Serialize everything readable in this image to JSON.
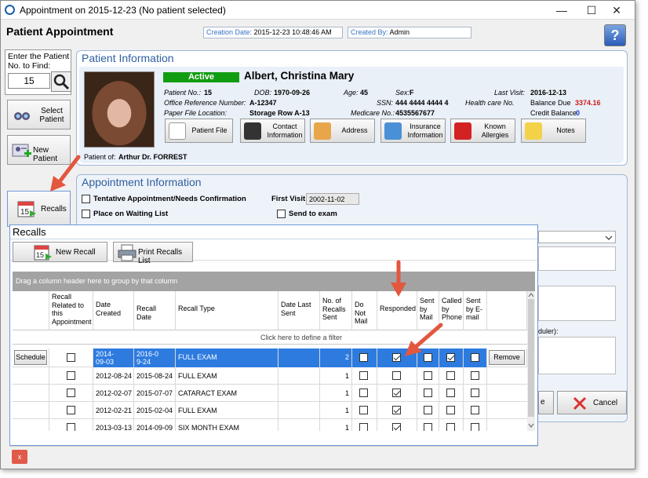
{
  "window": {
    "title": "Appointment on 2015-12-23 (No patient selected)",
    "min": "—",
    "max": "☐",
    "close": "✕"
  },
  "header": {
    "title": "Patient Appointment",
    "creation_label": "Creation Date:",
    "creation_value": "2015-12-23 10:48:46 AM",
    "created_by_label": "Created By:",
    "created_by_value": "Admin",
    "help": "?"
  },
  "sidebar": {
    "find_label": "Enter the Patient No. to Find:",
    "find_value": "15",
    "select_patient": "Select Patient",
    "new_patient": "New Patient",
    "recalls": "Recalls"
  },
  "patient": {
    "section_title": "Patient Information",
    "status": "Active",
    "name": "Albert, Christina Mary",
    "patient_no_label": "Patient No.:",
    "patient_no": "15",
    "dob_label": "DOB:",
    "dob": "1970-09-26",
    "age_label": "Age:",
    "age": "45",
    "sex_label": "Sex:",
    "sex": "F",
    "last_visit_label": "Last Visit:",
    "last_visit": "2016-12-13",
    "office_ref_label": "Office Reference Number:",
    "office_ref": "A-12347",
    "ssn_label": "SSN:",
    "ssn": "444 4444 4444 4",
    "hc_label": "Health care No.",
    "balance_due_label": "Balance Due",
    "balance_due": "3374.16",
    "paper_label": "Paper File Location:",
    "paper": "Storage Row A-13",
    "medicare_label": "Medicare No.:",
    "medicare": "4535567677",
    "credit_label": "Credit Balance",
    "credit": "0",
    "patient_of_label": "Patient of:",
    "patient_of": "Arthur Dr. FORREST",
    "buttons": [
      "Patient File",
      "Contact Information",
      "Address",
      "Insurance Information",
      "Known Allergies",
      "Notes"
    ]
  },
  "appointment": {
    "section_title": "Appointment Information",
    "tentative": "Tentative Appointment/Needs Confirmation",
    "first_visit_label": "First Visit",
    "first_visit": "2002-11-02",
    "waiting": "Place on Waiting List",
    "send_exam": "Send to exam",
    "scheduler_label": "duler):",
    "cancel": "Cancel",
    "partial_btn": "e"
  },
  "recalls": {
    "title": "Recalls",
    "new_recall": "New Recall",
    "print_list": "Print Recalls List",
    "group_hint": "Drag a column header here to group by that column",
    "filter_hint": "Click here to define a filter",
    "columns": [
      "",
      "Recall Related to this Appointment",
      "Date Created",
      "Recall Date",
      "Recall Type",
      "Date Last Sent",
      "No. of Recalls Sent",
      "Do Not Mail",
      "Responded",
      "Sent by Mail",
      "Called by Phone",
      "Sent by E-mail",
      ""
    ],
    "rows": [
      {
        "action": "Schedule",
        "created": "2014-09-03",
        "recall": "2016-09-24",
        "type": "FULL EXAM",
        "last": "",
        "count": "2",
        "remove": "Remove",
        "responded": true,
        "called": true,
        "selected": true
      },
      {
        "created": "2012-08-24",
        "recall": "2015-08-24",
        "type": "FULL EXAM",
        "last": "",
        "count": "1",
        "responded": false
      },
      {
        "created": "2012-02-07",
        "recall": "2015-07-07",
        "type": "CATARACT EXAM",
        "last": "",
        "count": "1",
        "responded": true
      },
      {
        "created": "2012-02-21",
        "recall": "2015-02-04",
        "type": "FULL EXAM",
        "last": "",
        "count": "1",
        "responded": true
      },
      {
        "created": "2013-03-13",
        "recall": "2014-09-09",
        "type": "SIX MONTH EXAM",
        "last": "",
        "count": "1",
        "responded": true
      }
    ],
    "close_x": "x"
  },
  "colors": {
    "accent": "#2e7be0",
    "active": "#119d11",
    "arrow": "#e2573e"
  }
}
